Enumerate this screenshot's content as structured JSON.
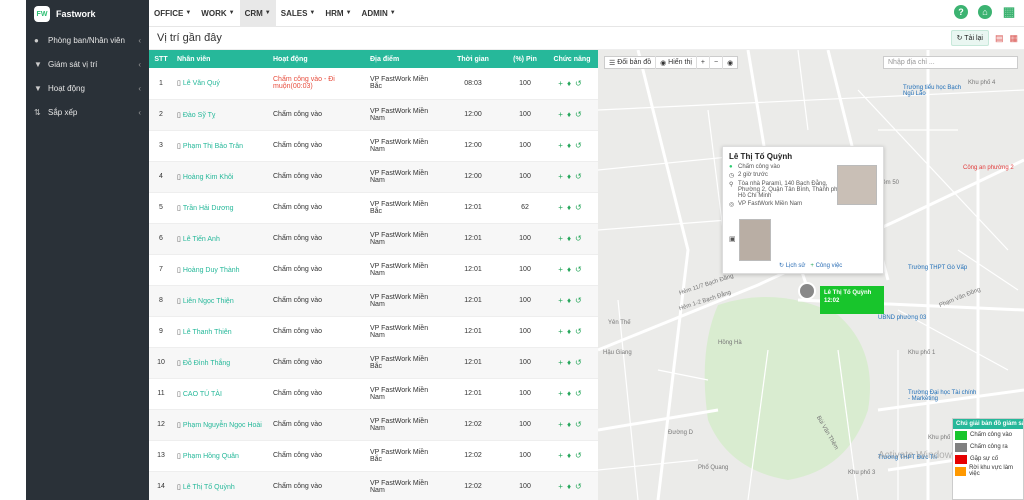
{
  "app": {
    "name": "Fastwork",
    "logo_text": "FW"
  },
  "sidebar": {
    "items": [
      {
        "label": "Phòng ban/Nhân viên",
        "icon": "users-icon"
      },
      {
        "label": "Giám sát vị trí",
        "icon": "filter-icon"
      },
      {
        "label": "Hoạt động",
        "icon": "filter-icon"
      },
      {
        "label": "Sắp xếp",
        "icon": "sort-icon"
      }
    ]
  },
  "topnav": {
    "menus": [
      {
        "label": "OFFICE"
      },
      {
        "label": "WORK"
      },
      {
        "label": "CRM",
        "active": true
      },
      {
        "label": "SALES"
      },
      {
        "label": "HRM"
      },
      {
        "label": "ADMIN"
      }
    ],
    "icons": [
      "help-icon",
      "home-icon",
      "apps-grid-icon"
    ]
  },
  "page": {
    "title": "Vị trí gần đây",
    "reload_label": "Tải lại"
  },
  "table": {
    "headers": [
      "STT",
      "Nhân viên",
      "Hoạt động",
      "Địa điểm",
      "Thời gian",
      "(%) Pin",
      "Chức năng"
    ],
    "rows": [
      {
        "stt": "1",
        "name": "Lê Văn Quý",
        "activity": "Chấm công vào - Đi muộn(00:03)",
        "late": true,
        "location": "VP FastWork Miền Bắc",
        "time": "08:03",
        "pin": "100"
      },
      {
        "stt": "2",
        "name": "Đào Sỹ Tỵ",
        "activity": "Chấm công vào",
        "late": false,
        "location": "VP FastWork Miền Nam",
        "time": "12:00",
        "pin": "100"
      },
      {
        "stt": "3",
        "name": "Phạm Thị Bảo Trân",
        "activity": "Chấm công vào",
        "late": false,
        "location": "VP FastWork Miền Nam",
        "time": "12:00",
        "pin": "100"
      },
      {
        "stt": "4",
        "name": "Hoàng Kim Khôi",
        "activity": "Chấm công vào",
        "late": false,
        "location": "VP FastWork Miền Nam",
        "time": "12:00",
        "pin": "100"
      },
      {
        "stt": "5",
        "name": "Trần Hải Dương",
        "activity": "Chấm công vào",
        "late": false,
        "location": "VP FastWork Miền Bắc",
        "time": "12:01",
        "pin": "62"
      },
      {
        "stt": "6",
        "name": "Lê Tiến Anh",
        "activity": "Chấm công vào",
        "late": false,
        "location": "VP FastWork Miền Nam",
        "time": "12:01",
        "pin": "100"
      },
      {
        "stt": "7",
        "name": "Hoàng Duy Thành",
        "activity": "Chấm công vào",
        "late": false,
        "location": "VP FastWork Miền Nam",
        "time": "12:01",
        "pin": "100"
      },
      {
        "stt": "8",
        "name": "Liên Ngọc Thiện",
        "activity": "Chấm công vào",
        "late": false,
        "location": "VP FastWork Miền Nam",
        "time": "12:01",
        "pin": "100"
      },
      {
        "stt": "9",
        "name": "Lê Thanh Thiên",
        "activity": "Chấm công vào",
        "late": false,
        "location": "VP FastWork Miền Nam",
        "time": "12:01",
        "pin": "100"
      },
      {
        "stt": "10",
        "name": "Đỗ Đình Thắng",
        "activity": "Chấm công vào",
        "late": false,
        "location": "VP FastWork Miền Bắc",
        "time": "12:01",
        "pin": "100"
      },
      {
        "stt": "11",
        "name": "CAO TÚ TÀI",
        "activity": "Chấm công vào",
        "late": false,
        "location": "VP FastWork Miền Nam",
        "time": "12:01",
        "pin": "100"
      },
      {
        "stt": "12",
        "name": "Phạm Nguyễn Ngọc Hoài",
        "activity": "Chấm công vào",
        "late": false,
        "location": "VP FastWork Miền Nam",
        "time": "12:02",
        "pin": "100"
      },
      {
        "stt": "13",
        "name": "Phạm Hồng Quân",
        "activity": "Chấm công vào",
        "late": false,
        "location": "VP FastWork Miền Bắc",
        "time": "12:02",
        "pin": "100"
      },
      {
        "stt": "14",
        "name": "Lê Thị Tố Quỳnh",
        "activity": "Chấm công vào",
        "late": false,
        "location": "VP FastWork Miền Nam",
        "time": "12:02",
        "pin": "100"
      }
    ],
    "actions": [
      "plus-icon",
      "bell-icon",
      "history-icon"
    ]
  },
  "map": {
    "toolbar": {
      "map_switch": "Đổi bản đồ",
      "show": "Hiển thị",
      "zoom_in": "+",
      "zoom_out": "−"
    },
    "search_placeholder": "Nhập địa chỉ ...",
    "popup": {
      "name": "Lê Thị Tố Quỳnh",
      "status": "Chấm công vào",
      "time_ago": "2 giờ trước",
      "address": "Tòa nhà Paramì, 140 Bạch Đằng, Phường 2, Quận Tân Bình, Thành phố Hồ Chí Minh",
      "office": "VP FastWork Miền Nam",
      "history_link": "Lịch sử",
      "work_link": "Công việc"
    },
    "marker_badge": {
      "name": "Lê Thị Tố Quỳnh",
      "time": "12:02"
    },
    "labels": [
      {
        "text": "Trường tiểu học Bạch Ngũ Lão",
        "red": false
      },
      {
        "text": "Công an phường 2",
        "red": true
      },
      {
        "text": "Trường THPT Gò Vấp",
        "red": false
      },
      {
        "text": "UBND phường 03",
        "red": false
      },
      {
        "text": "Trường Đại học Tài chính - Marketing",
        "red": false
      },
      {
        "text": "Trường THPT Đức Trí",
        "red": false
      }
    ],
    "roads": [
      "Hẻm 11/7 Bạch Đằng",
      "Hẻm 1-2 Bạch Đằng",
      "Phạm Văn Đồng",
      "Hồng Hà",
      "Hậu Giang",
      "Bùi Văn Thêm",
      "Phổ Quang",
      "Khu phố 1",
      "Khu phố 2",
      "Khu phố 3",
      "Khu phố 4",
      "Đường D",
      "Yên Thế",
      "Hẻm 50"
    ],
    "watermark": "Activate Windows",
    "legend": {
      "title": "Chú giải bản đồ giám sát",
      "items": [
        {
          "label": "Chấm công vào",
          "color": "#18c52c"
        },
        {
          "label": "Chấm công ra",
          "color": "#808080"
        },
        {
          "label": "Gặp sự cố",
          "color": "#e60000"
        },
        {
          "label": "Rời khu vực làm việc",
          "color": "#ff9900"
        }
      ]
    }
  },
  "colors": {
    "accent": "#26b89a",
    "sidebar": "#2a3138",
    "late": "#e74c3c",
    "link": "#26b89a"
  }
}
